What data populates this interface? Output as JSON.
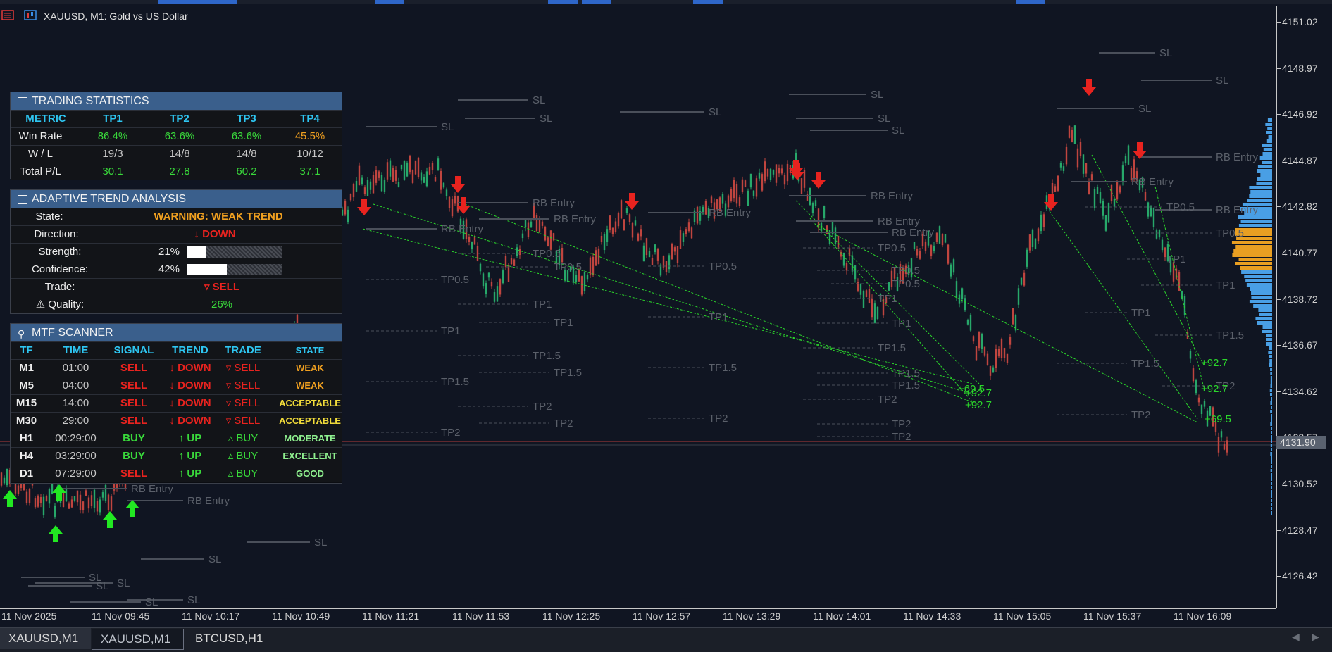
{
  "window": {
    "title": "XAUUSD, M1:  Gold vs US Dollar"
  },
  "colors": {
    "bg": "#101522",
    "bull": "#27a86a",
    "bear": "#c0453f",
    "sell_arrow": "#e8231f",
    "buy_arrow": "#22e822",
    "accent_blue": "#3a5f8c"
  },
  "price_axis": {
    "labels": [
      "4151.02",
      "4148.97",
      "4146.92",
      "4144.87",
      "4142.82",
      "4140.77",
      "4138.72",
      "4136.67",
      "4134.62",
      "4132.57",
      "4130.52",
      "4128.47",
      "4126.42"
    ],
    "current": "4131.90"
  },
  "time_axis": {
    "labels": [
      "11 Nov 2025",
      "11 Nov 09:45",
      "11 Nov 10:17",
      "11 Nov 10:49",
      "11 Nov 11:21",
      "11 Nov 11:53",
      "11 Nov 12:25",
      "11 Nov 12:57",
      "11 Nov 13:29",
      "11 Nov 14:01",
      "11 Nov 14:33",
      "11 Nov 15:05",
      "11 Nov 15:37",
      "11 Nov 16:09"
    ]
  },
  "overlay_labels": {
    "sl": "SL",
    "rb_entry": "RB Entry",
    "tp05": "TP0.5",
    "tp1": "TP1",
    "tp15": "TP1.5",
    "tp2": "TP2",
    "gain_a": "+92.7",
    "gain_b": "+69.5",
    "gain_c": "+92.7"
  },
  "stats": {
    "title": "TRADING STATISTICS",
    "headers": [
      "METRIC",
      "TP1",
      "TP2",
      "TP3",
      "TP4"
    ],
    "rows": [
      {
        "label": "Win Rate",
        "values": [
          "86.4%",
          "63.6%",
          "63.6%",
          "45.5%"
        ]
      },
      {
        "label": "W / L",
        "values": [
          "19/3",
          "14/8",
          "14/8",
          "10/12"
        ]
      },
      {
        "label": "Total P/L",
        "values": [
          "30.1",
          "27.8",
          "60.2",
          "37.1"
        ]
      }
    ]
  },
  "trend": {
    "title": "ADAPTIVE TREND ANALYSIS",
    "state_label": "State:",
    "state": "WARNING: WEAK TREND",
    "direction_label": "Direction:",
    "direction": "↓ DOWN",
    "strength_label": "Strength:",
    "strength": "21%",
    "strength_value": 0.21,
    "confidence_label": "Confidence:",
    "confidence": "42%",
    "confidence_value": 0.42,
    "trade_label": "Trade:",
    "trade": "▿ SELL",
    "quality_label": "Quality:",
    "quality": "26%"
  },
  "mtf": {
    "title": "MTF SCANNER",
    "headers": [
      "TF",
      "TIME",
      "SIGNAL",
      "TREND",
      "TRADE",
      "STATE"
    ],
    "rows": [
      {
        "tf": "M1",
        "time": "01:00",
        "signal": "SELL",
        "trend": "↓ DOWN",
        "trade": "▿ SELL",
        "state": "WEAK"
      },
      {
        "tf": "M5",
        "time": "04:00",
        "signal": "SELL",
        "trend": "↓ DOWN",
        "trade": "▿ SELL",
        "state": "WEAK"
      },
      {
        "tf": "M15",
        "time": "14:00",
        "signal": "SELL",
        "trend": "↓ DOWN",
        "trade": "▿ SELL",
        "state": "ACCEPTABLE"
      },
      {
        "tf": "M30",
        "time": "29:00",
        "signal": "SELL",
        "trend": "↓ DOWN",
        "trade": "▿ SELL",
        "state": "ACCEPTABLE"
      },
      {
        "tf": "H1",
        "time": "00:29:00",
        "signal": "BUY",
        "trend": "↑ UP",
        "trade": "▵ BUY",
        "state": "MODERATE"
      },
      {
        "tf": "H4",
        "time": "03:29:00",
        "signal": "BUY",
        "trend": "↑ UP",
        "trade": "▵ BUY",
        "state": "EXCELLENT"
      },
      {
        "tf": "D1",
        "time": "07:29:00",
        "signal": "SELL",
        "trend": "↑ UP",
        "trade": "▵ BUY",
        "state": "GOOD"
      }
    ]
  },
  "tabs": [
    "XAUUSD,M1",
    "XAUUSD,M1",
    "BTCUSD,H1"
  ]
}
